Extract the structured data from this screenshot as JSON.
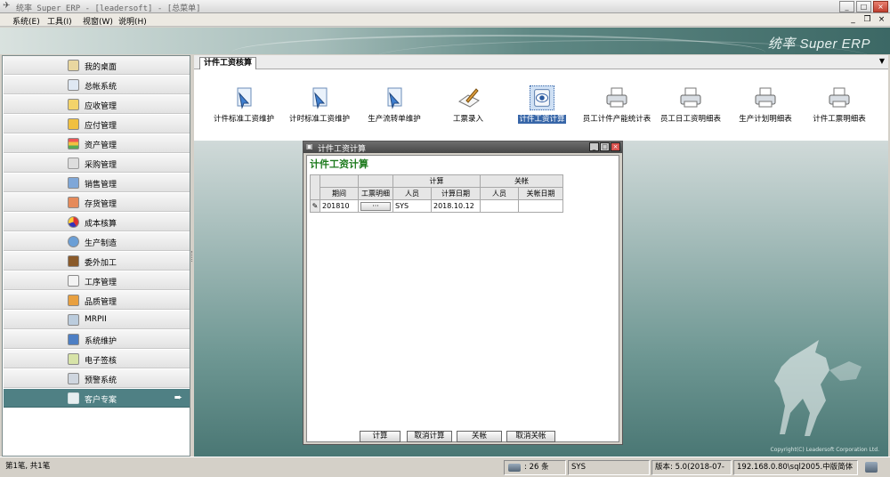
{
  "window": {
    "title": "统率 Super ERP - [leadersoft] - [总菜单]",
    "controls": [
      "_",
      "□",
      "×"
    ]
  },
  "menu": {
    "items": [
      "系统(E)",
      "工具(I)",
      "视窗(W)",
      "说明(H)"
    ],
    "mdi_controls": [
      "_",
      "❐",
      "×"
    ]
  },
  "banner": {
    "brand": "统率 Super ERP"
  },
  "sidebar": {
    "items": [
      {
        "label": "我的桌面",
        "icon": "desktop-icon"
      },
      {
        "label": "总帐系统",
        "icon": "ledger-icon"
      },
      {
        "label": "应收管理",
        "icon": "receivable-icon"
      },
      {
        "label": "应付管理",
        "icon": "payable-icon"
      },
      {
        "label": "资产管理",
        "icon": "asset-icon"
      },
      {
        "label": "采购管理",
        "icon": "cart-icon"
      },
      {
        "label": "销售管理",
        "icon": "sales-icon"
      },
      {
        "label": "存货管理",
        "icon": "inventory-icon"
      },
      {
        "label": "成本核算",
        "icon": "pie-chart-icon"
      },
      {
        "label": "生产制造",
        "icon": "gear-icon"
      },
      {
        "label": "委外加工",
        "icon": "briefcase-icon"
      },
      {
        "label": "工序管理",
        "icon": "process-icon"
      },
      {
        "label": "品质管理",
        "icon": "quality-icon"
      },
      {
        "label": "MRPII",
        "icon": "mrp-icon"
      },
      {
        "label": "系统维护",
        "icon": "monitor-icon"
      },
      {
        "label": "电子签核",
        "icon": "sign-icon"
      },
      {
        "label": "预警系统",
        "icon": "alert-icon"
      },
      {
        "label": "客户专案",
        "icon": "customer-icon"
      }
    ],
    "active_arrow": "➨"
  },
  "tab": {
    "label": "计件工资核算",
    "dropdown": "▼"
  },
  "tools": [
    {
      "label": "计件标准工资维护",
      "icon": "cursor-doc-icon"
    },
    {
      "label": "计时标准工资维护",
      "icon": "cursor-doc-icon"
    },
    {
      "label": "生产流转单维护",
      "icon": "cursor-doc-icon"
    },
    {
      "label": "工票录入",
      "icon": "pen-doc-icon"
    },
    {
      "label": "计件工资计算",
      "icon": "eye-calc-icon"
    },
    {
      "label": "员工计件产能统计表",
      "icon": "printer-icon"
    },
    {
      "label": "员工日工资明细表",
      "icon": "printer-icon"
    },
    {
      "label": "生产计划明细表",
      "icon": "printer-icon"
    },
    {
      "label": "计件工票明细表",
      "icon": "printer-icon"
    }
  ],
  "child_window": {
    "title": "计件工资计算",
    "heading": "计件工资计算",
    "group_headers": {
      "calc": "计算",
      "close": "关帐"
    },
    "columns": [
      "期间",
      "工票明细",
      "人员",
      "计算日期",
      "人员",
      "关帐日期"
    ],
    "rows": [
      {
        "period": "201810",
        "detail": "···",
        "calc_user": "SYS",
        "calc_date": "2018.10.12",
        "close_user": "",
        "close_date": ""
      }
    ],
    "buttons": [
      "计算",
      "取消计算",
      "关帐",
      "取消关帐"
    ]
  },
  "footer": {
    "copyright": "Copyright(C) Leadersoft Corporation Ltd."
  },
  "status": {
    "records": "第1笔, 共1笔",
    "count": ": 26 条",
    "user": "SYS",
    "version": "版本: 5.0(2018-07-",
    "server": "192.168.0.80\\sql2005.中版简体"
  }
}
